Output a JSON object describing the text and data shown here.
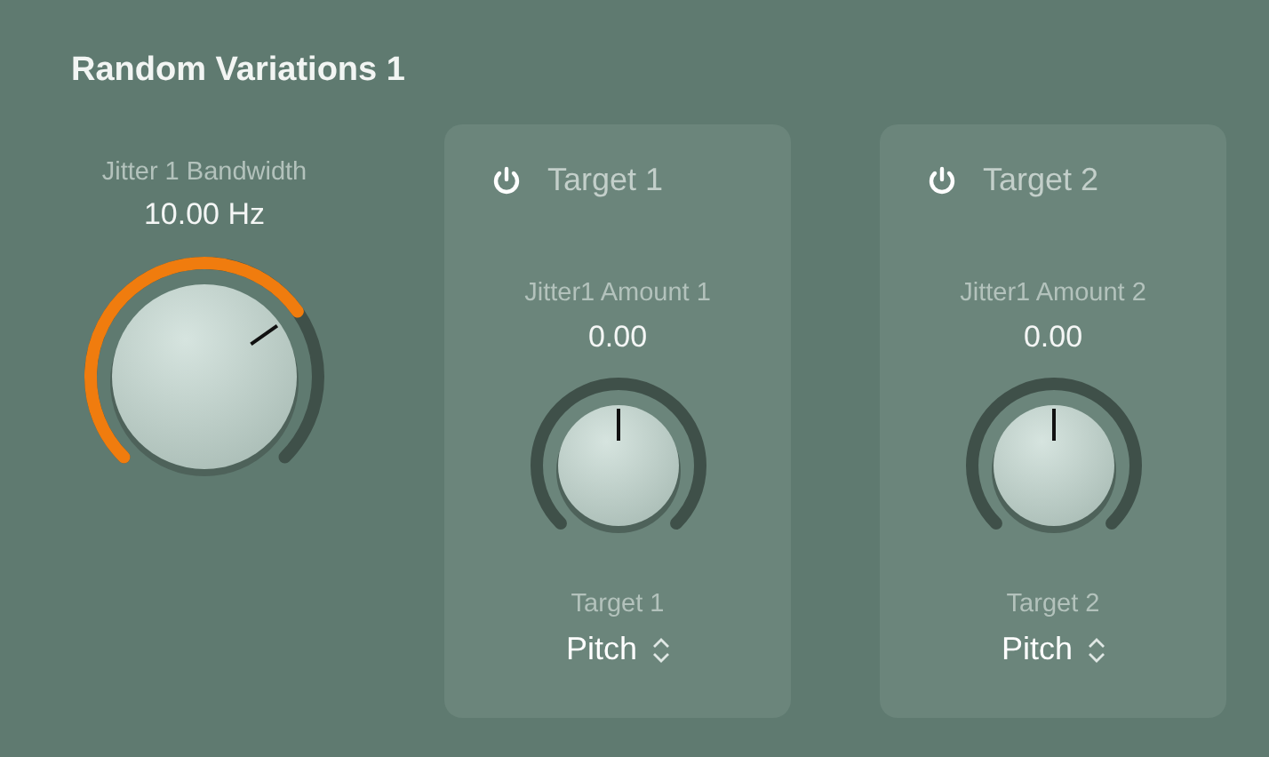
{
  "title": "Random Variations 1",
  "bandwidth": {
    "label": "Jitter 1 Bandwidth",
    "value": "10.00 Hz",
    "knob": {
      "kind": "unipolar"
    }
  },
  "targets": [
    {
      "on": true,
      "title": "Target 1",
      "amount_label": "Jitter1 Amount 1",
      "amount": "0.00",
      "knob": {
        "kind": "bipolar"
      },
      "target_label": "Target 1",
      "target_value": "Pitch"
    },
    {
      "on": true,
      "title": "Target 2",
      "amount_label": "Jitter1 Amount 2",
      "amount": "0.00",
      "knob": {
        "kind": "bipolar"
      },
      "target_label": "Target 2",
      "target_value": "Pitch"
    }
  ]
}
